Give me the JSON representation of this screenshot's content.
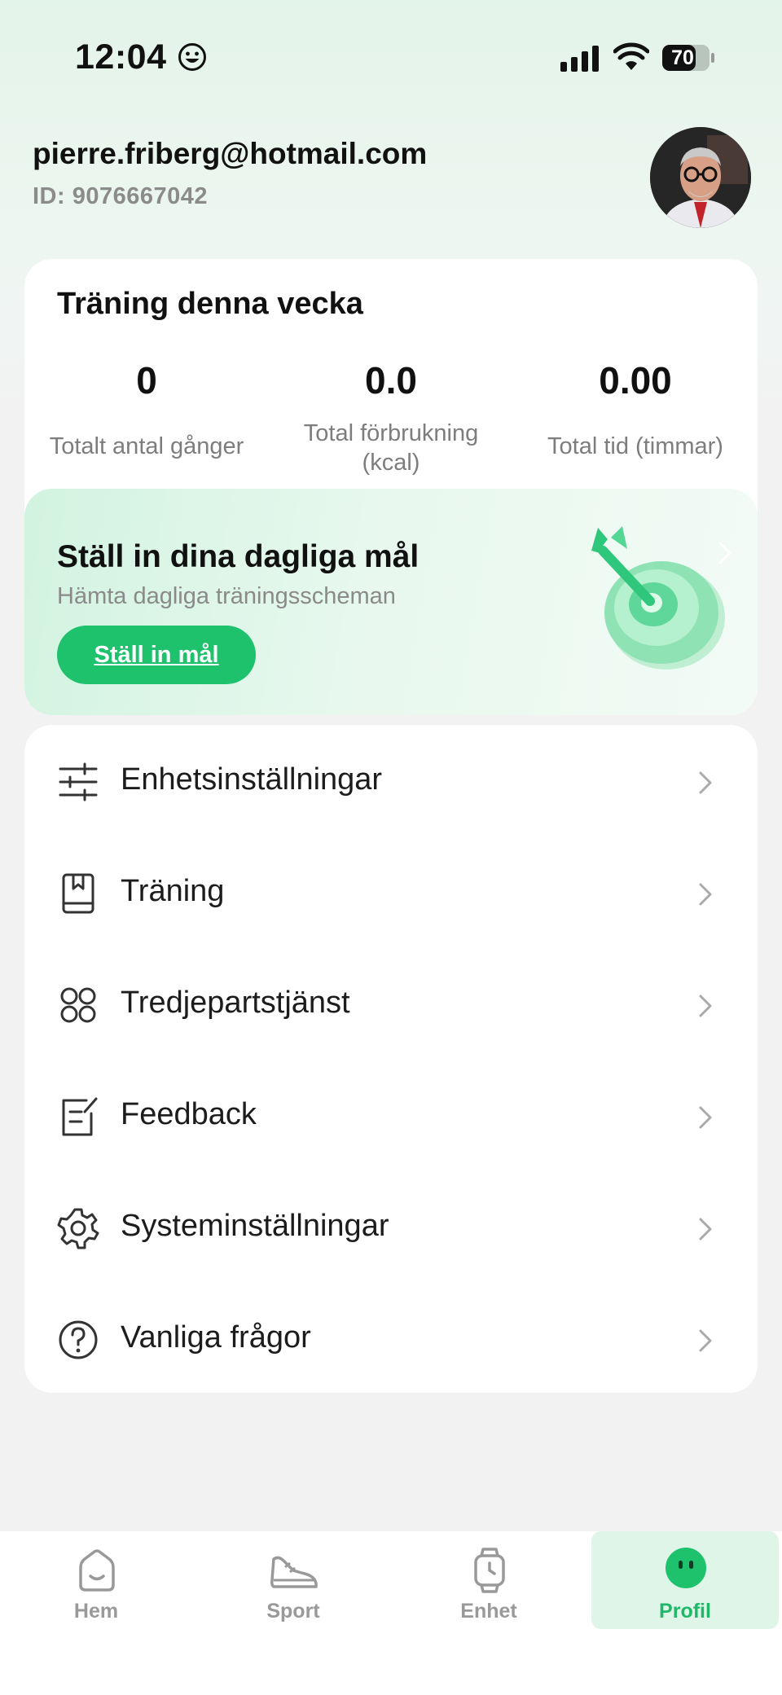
{
  "status_bar": {
    "time": "12:04",
    "battery": "70"
  },
  "header": {
    "email": "pierre.friberg@hotmail.com",
    "id_text": "ID: 9076667042"
  },
  "weekly": {
    "title": "Träning denna vecka",
    "stats": [
      {
        "value": "0",
        "label": "Totalt antal gånger"
      },
      {
        "value": "0.0",
        "label_line1": "Total förbrukning",
        "label_line2": "(kcal)"
      },
      {
        "value": "0.00",
        "label": "Total tid (timmar)"
      }
    ]
  },
  "goal_banner": {
    "title": "Ställ in dina dagliga mål",
    "subtitle": "Hämta dagliga träningsscheman",
    "button": "Ställ in mål"
  },
  "menu": [
    {
      "icon": "sliders-icon",
      "label": "Enhetsinställningar"
    },
    {
      "icon": "book-icon",
      "label": "Träning"
    },
    {
      "icon": "apps-icon",
      "label": "Tredjepartstjänst"
    },
    {
      "icon": "feedback-icon",
      "label": "Feedback"
    },
    {
      "icon": "gear-icon",
      "label": "Systeminställningar"
    },
    {
      "icon": "question-icon",
      "label": "Vanliga frågor"
    }
  ],
  "bottom_nav": [
    {
      "icon": "home-icon",
      "label": "Hem",
      "active": false
    },
    {
      "icon": "shoe-icon",
      "label": "Sport",
      "active": false
    },
    {
      "icon": "watch-icon",
      "label": "Enhet",
      "active": false
    },
    {
      "icon": "profile-icon",
      "label": "Profil",
      "active": true
    }
  ],
  "colors": {
    "accent": "#1ec26d",
    "nav_active_bg": "#dff5e8",
    "nav_active_text": "#1eb868",
    "muted_text": "#8b8b8b"
  }
}
